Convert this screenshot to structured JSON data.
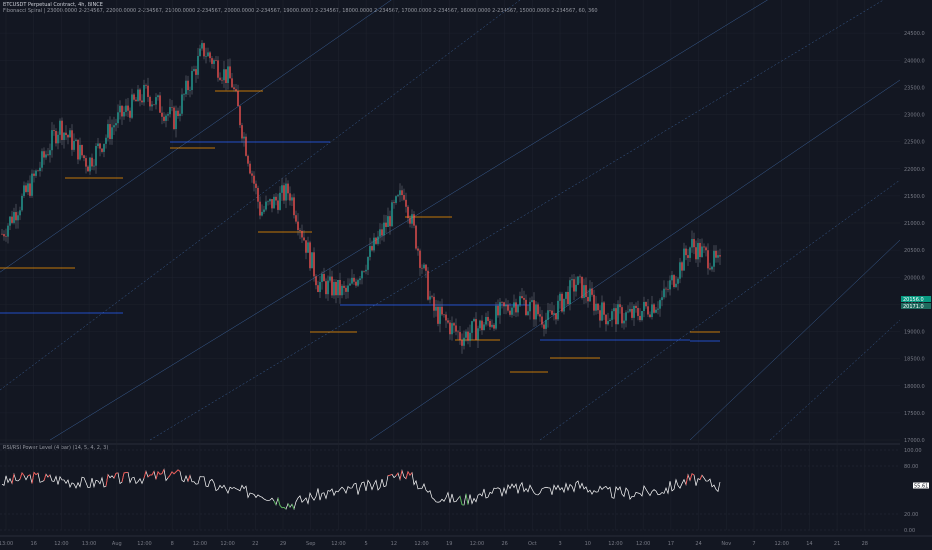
{
  "header": {
    "symbol": "BTCUSDT Perpetual Contract, 4h, BINCE",
    "indicator": "Fibonacci Spiral | 23000.0000 2-234567, 22000.0000 2-234567, 21000.0000 2-234567, 20000.0000 2-234567, 19000.0000 2-234567, 18000.0000 2-234567, 17000.0000 2-234567, 16000.0000 2-234567, 15000.0000 2-234567, 60, 360"
  },
  "subpane": {
    "title": "RSI/RSI Power Level (4 bar) (14, 5, 4, 2, 3)",
    "price_badge": "55.61"
  },
  "price_badges": [
    "20156.0",
    "20171.0"
  ],
  "colors": {
    "background": "#131722",
    "bull": "#26a69a",
    "bear": "#ef5350",
    "wick": "#787b86",
    "level_orange": "#ff9800",
    "level_blue": "#2962ff",
    "fib_line": "#5b9cf6",
    "rsi_line": "#ffffff",
    "rsi_high": "#ef5350",
    "rsi_low": "#4caf50",
    "badge_green": "#089981"
  },
  "chart_data": [
    {
      "type": "candlestick",
      "title": "",
      "xlabel": "",
      "ylabel": "",
      "x_ticks": [
        "13:00",
        "16",
        "12:00",
        "13:00",
        "Aug",
        "12:00",
        "8",
        "12:00",
        "12:00",
        "22",
        "29",
        "Sep",
        "12:00",
        "5",
        "12",
        "12:00",
        "19",
        "12:00",
        "26",
        "Oct",
        "3",
        "10",
        "12:00",
        "12:00",
        "17",
        "24",
        "Nov",
        "7",
        "12:00",
        "14",
        "21",
        "28"
      ],
      "y_ticks": [
        "24500.0",
        "24000.0",
        "23500.0",
        "23000.0",
        "22500.0",
        "22000.0",
        "21500.0",
        "21000.0",
        "20500.0",
        "20000.0",
        "19500.0",
        "19000.0",
        "18500.0",
        "18000.0",
        "17500.0",
        "17000.0"
      ],
      "ylim": [
        17000,
        25000
      ],
      "grid": true,
      "x": [
        "13:00",
        "16",
        "12:00",
        "13:00",
        "Aug",
        "12:00",
        "8",
        "12:00",
        "12:00",
        "22",
        "29",
        "Sep",
        "12:00",
        "5",
        "12",
        "12:00",
        "19",
        "12:00",
        "26",
        "Oct",
        "3",
        "10",
        "12:00",
        "12:00",
        "17",
        "24"
      ],
      "series": [
        {
          "close": [
            20800,
            21700,
            22800,
            22100,
            22900,
            23400,
            22900,
            24200,
            23600,
            21200,
            21600,
            19900,
            19700,
            20600,
            21600,
            19400,
            18900,
            19200,
            19600,
            19200,
            19900,
            19300,
            19300,
            19600,
            20600,
            20200
          ]
        }
      ]
    },
    {
      "type": "line",
      "title": "",
      "x": [
        "13:00",
        "16",
        "12:00",
        "13:00",
        "Aug",
        "12:00",
        "8",
        "12:00",
        "12:00",
        "22",
        "29",
        "Sep",
        "12:00",
        "5",
        "12",
        "12:00",
        "19",
        "12:00",
        "26",
        "Oct",
        "3",
        "10",
        "12:00",
        "12:00",
        "17",
        "24"
      ],
      "ylim": [
        0,
        100
      ],
      "y_ticks": [
        "100.00",
        "80.00",
        "20.00",
        "0.00"
      ],
      "series": [
        {
          "values": [
            60,
            66,
            63,
            58,
            64,
            66,
            70,
            60,
            49,
            47,
            32,
            44,
            49,
            56,
            73,
            43,
            37,
            48,
            52,
            50,
            56,
            47,
            46,
            50,
            64,
            55
          ]
        }
      ]
    }
  ]
}
